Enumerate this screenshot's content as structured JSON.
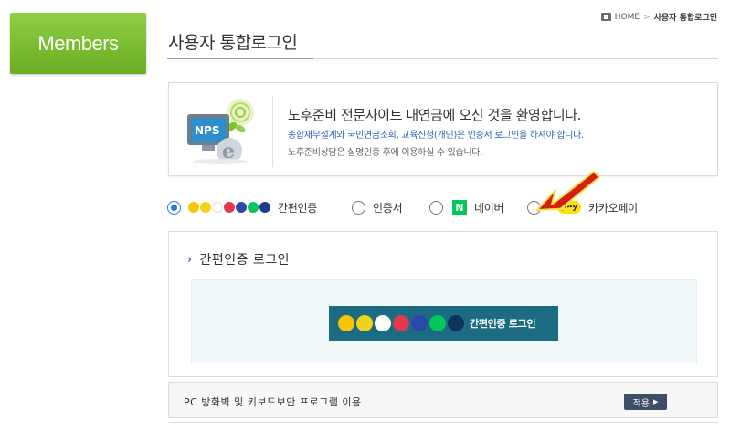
{
  "sidebar": {
    "members_label": "Members"
  },
  "breadcrumb": {
    "home": "HOME",
    "separator": ">",
    "current": "사용자 통합로그인"
  },
  "page": {
    "title": "사용자 통합로그인"
  },
  "welcome": {
    "icon_text": "NPS",
    "title": "노후준비 전문사이트 내연금에 오신 것을 환영합니다.",
    "line1": "종합재무설계와 국민연금조회, 교육신청(개인)은 인증서 로그인을 하셔야 합니다.",
    "line2": "노후준비상담은 실명인증 후에 이용하실 수 있습니다."
  },
  "login_options": {
    "simple": "간편인증",
    "cert": "인증서",
    "naver": "네이버",
    "naver_badge": "N",
    "kakao_badge": "pay",
    "kakao": "카카오페이",
    "selected": "simple"
  },
  "simple_login": {
    "title": "간편인증 로그인",
    "button_label": "간편인증 로그인"
  },
  "firewall": {
    "label": "PC 방화벽 및 키보드보안 프로그램 이용",
    "apply_label": "적용"
  },
  "colors": {
    "members_green": "#7bbf32",
    "primary_blue": "#2a7ae2",
    "button_teal": "#1b6b82",
    "apply_navy": "#3c4f66",
    "arrow_red": "#d21f0f"
  }
}
